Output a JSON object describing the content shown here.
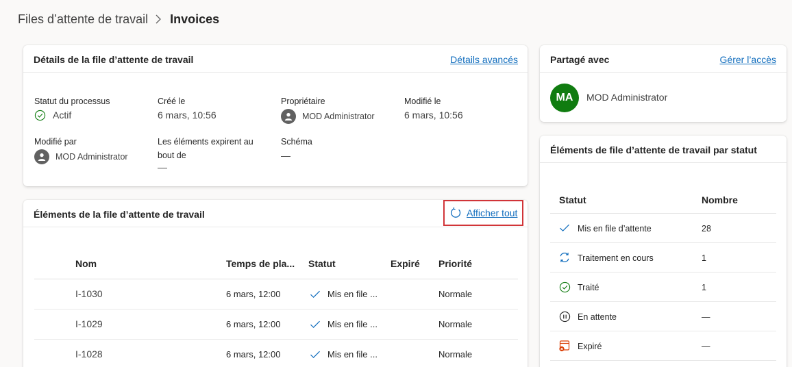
{
  "breadcrumb": {
    "parent": "Files d’attente de travail",
    "current": "Invoices"
  },
  "details": {
    "title": "Détails de la file d’attente de travail",
    "advanced_link": "Détails avancés",
    "fields": {
      "status_label": "Statut du processus",
      "status_value": "Actif",
      "created_label": "Créé le",
      "created_value": "6 mars, 10:56",
      "owner_label": "Propriétaire",
      "owner_value": "MOD Administrator",
      "modified_label": "Modifié le",
      "modified_value": "6 mars, 10:56",
      "modified_by_label": "Modifié par",
      "modified_by_value": "MOD Administrator",
      "expire_label_line1": "Les éléments expirent au",
      "expire_label_line2": "bout de",
      "expire_value": "—",
      "schema_label": "Schéma",
      "schema_value": "—"
    }
  },
  "items": {
    "title": "Éléments de la file d’attente de travail",
    "show_all": "Afficher tout",
    "columns": {
      "name": "Nom",
      "time": "Temps de pla...",
      "status": "Statut",
      "expired": "Expiré",
      "priority": "Priorité"
    },
    "rows": [
      {
        "name": "I-1030",
        "time": "6 mars, 12:00",
        "status": "Mis en file ...",
        "expired": "",
        "priority": "Normale"
      },
      {
        "name": "I-1029",
        "time": "6 mars, 12:00",
        "status": "Mis en file ...",
        "expired": "",
        "priority": "Normale"
      },
      {
        "name": "I-1028",
        "time": "6 mars, 12:00",
        "status": "Mis en file ...",
        "expired": "",
        "priority": "Normale"
      }
    ]
  },
  "shared": {
    "title": "Partagé avec",
    "manage_link": "Gérer l’accès",
    "user_initials": "MA",
    "user_name": "MOD Administrator"
  },
  "by_status": {
    "title": "Éléments de file d’attente de travail par statut",
    "col_status": "Statut",
    "col_count": "Nombre",
    "rows": [
      {
        "icon": "checkmark-icon",
        "label": "Mis en file d’attente",
        "count": "28"
      },
      {
        "icon": "processing-icon",
        "label": "Traitement en cours",
        "count": "1"
      },
      {
        "icon": "check-circle-icon",
        "label": "Traité",
        "count": "1"
      },
      {
        "icon": "pause-circle-icon",
        "label": "En attente",
        "count": "—"
      },
      {
        "icon": "expired-icon",
        "label": "Expiré",
        "count": "—"
      }
    ]
  },
  "colors": {
    "accent_link": "#0f6cbd",
    "active_green": "#107c10",
    "highlight_red": "#d13438",
    "expired_orange": "#da3b01"
  }
}
